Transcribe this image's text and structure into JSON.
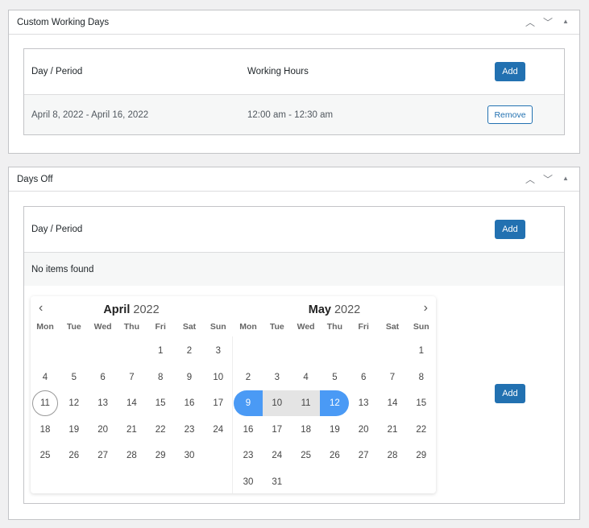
{
  "custom_working_days": {
    "title": "Custom Working Days",
    "col_day": "Day / Period",
    "col_hours": "Working Hours",
    "add_label": "Add",
    "rows": [
      {
        "period": "April 8, 2022 - April 16, 2022",
        "hours": "12:00 am - 12:30 am",
        "remove_label": "Remove"
      }
    ]
  },
  "days_off": {
    "title": "Days Off",
    "col_day": "Day / Period",
    "add_label": "Add",
    "empty": "No items found",
    "add2_label": "Add"
  },
  "controls": {
    "up": "⌃",
    "down": "⌄",
    "toggle": "▲"
  },
  "calendar": {
    "weekdays": [
      "Mon",
      "Tue",
      "Wed",
      "Thu",
      "Fri",
      "Sat",
      "Sun"
    ],
    "months": [
      {
        "name": "April",
        "year": "2022",
        "first_weekday": 4,
        "days": 30
      },
      {
        "name": "May",
        "year": "2022",
        "first_weekday": 6,
        "days": 31
      }
    ],
    "today": {
      "month": 0,
      "day": 11
    },
    "range": {
      "month": 1,
      "start": 9,
      "end": 12
    },
    "prev": "‹",
    "next": "›"
  }
}
